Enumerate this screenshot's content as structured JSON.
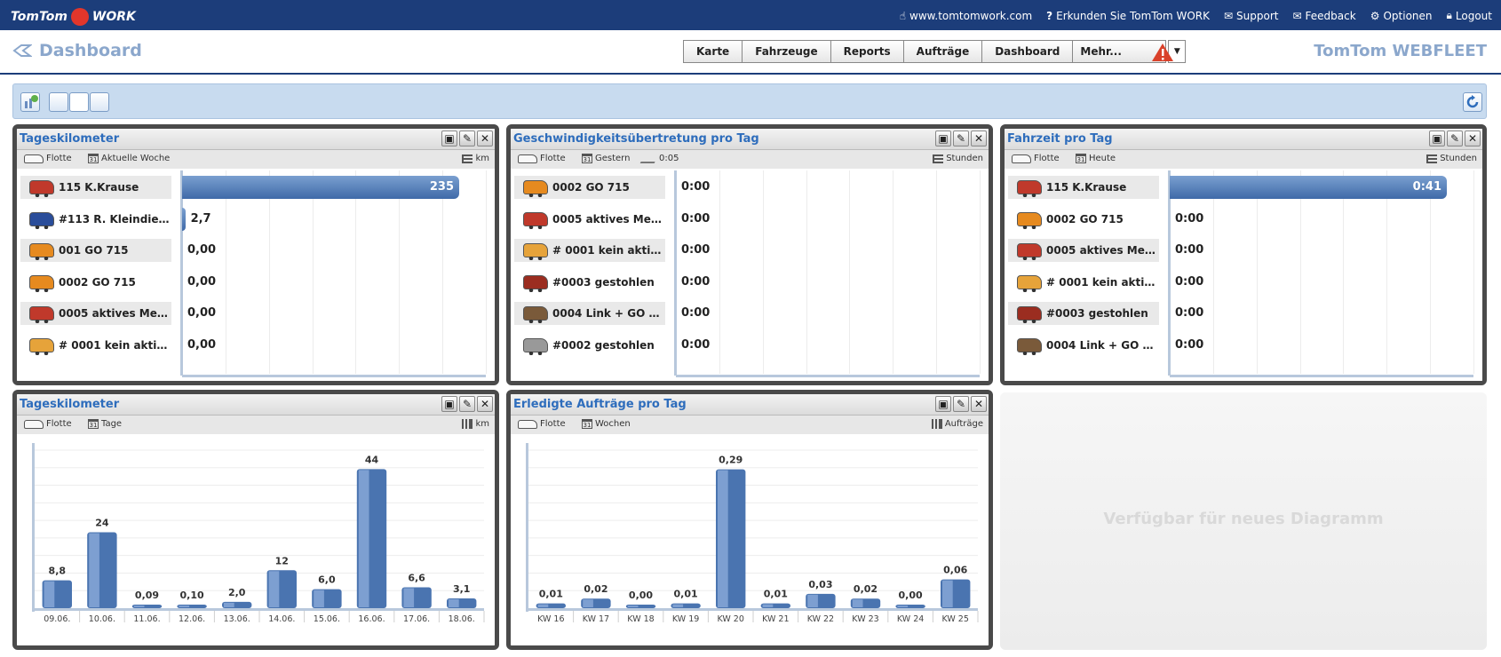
{
  "app": {
    "brand_logo": "TomTom",
    "brand_work": "WORK",
    "product": "TomTom WEBFLEET"
  },
  "toplinks": [
    {
      "icon": "pointer-icon",
      "label": "www.tomtomwork.com"
    },
    {
      "icon": "help-icon",
      "label": "Erkunden Sie TomTom WORK"
    },
    {
      "icon": "mail-icon",
      "label": "Support"
    },
    {
      "icon": "mail-icon",
      "label": "Feedback"
    },
    {
      "icon": "gear-icon",
      "label": "Optionen"
    },
    {
      "icon": "lock-icon",
      "label": "Logout"
    }
  ],
  "page_title": "Dashboard",
  "nav": [
    "Karte",
    "Fahrzeuge",
    "Reports",
    "Aufträge",
    "Dashboard"
  ],
  "nav_more": "Mehr...",
  "available": "Verfügbar für neues Diagramm",
  "colors": {
    "topbar": "#1c3d7a",
    "bar": "#4a74b0",
    "title": "#2e6dbc",
    "warning": "#d9412a"
  },
  "w1": {
    "title": "Tageskilometer",
    "filter1": "Flotte",
    "filter2": "Aktuelle Woche",
    "unit": "km",
    "rows": [
      {
        "vehicle": "115 K.Krause",
        "value": "235",
        "num": 235,
        "color": "#c0392b"
      },
      {
        "vehicle": "#113 R. Kleindiek Ca...",
        "value": "2,7",
        "num": 2.7,
        "color": "#2a4d9a"
      },
      {
        "vehicle": "001 GO 715",
        "value": "0,00",
        "num": 0,
        "color": "#e68a1f"
      },
      {
        "vehicle": "0002 GO 715",
        "value": "0,00",
        "num": 0,
        "color": "#e68a1f"
      },
      {
        "vehicle": "0005 aktives Messe...",
        "value": "0,00",
        "num": 0,
        "color": "#c0392b"
      },
      {
        "vehicle": "# 0001 kein aktives ...",
        "value": "0,00",
        "num": 0,
        "color": "#e6a33a"
      }
    ]
  },
  "w2": {
    "title": "Geschwindigkeitsübertretung pro Tag",
    "filter1": "Flotte",
    "filter2": "Gestern",
    "filter3": "0:05",
    "unit": "Stunden",
    "rows": [
      {
        "vehicle": "0002 GO 715",
        "value": "0:00",
        "color": "#e68a1f"
      },
      {
        "vehicle": "0005 aktives Messe...",
        "value": "0:00",
        "color": "#c0392b"
      },
      {
        "vehicle": "# 0001 kein aktives ...",
        "value": "0:00",
        "color": "#e6a33a"
      },
      {
        "vehicle": "#0003 gestohlen",
        "value": "0:00",
        "color": "#9b2d20"
      },
      {
        "vehicle": "0004 Link + GO 730",
        "value": "0:00",
        "color": "#7a5a3a"
      },
      {
        "vehicle": "#0002 gestohlen",
        "value": "0:00",
        "color": "#999999"
      }
    ]
  },
  "w3": {
    "title": "Fahrzeit pro Tag",
    "filter1": "Flotte",
    "filter2": "Heute",
    "unit": "Stunden",
    "rows": [
      {
        "vehicle": "115 K.Krause",
        "value": "0:41",
        "num": 41,
        "color": "#c0392b"
      },
      {
        "vehicle": "0002 GO 715",
        "value": "0:00",
        "num": 0,
        "color": "#e68a1f"
      },
      {
        "vehicle": "0005 aktives Messe...",
        "value": "0:00",
        "num": 0,
        "color": "#c0392b"
      },
      {
        "vehicle": "# 0001 kein aktives ...",
        "value": "0:00",
        "num": 0,
        "color": "#e6a33a"
      },
      {
        "vehicle": "#0003 gestohlen",
        "value": "0:00",
        "num": 0,
        "color": "#9b2d20"
      },
      {
        "vehicle": "0004 Link + GO 730",
        "value": "0:00",
        "num": 0,
        "color": "#7a5a3a"
      }
    ]
  },
  "w4": {
    "title": "Tageskilometer",
    "filter1": "Flotte",
    "filter2": "Tage",
    "unit": "km"
  },
  "w5": {
    "title": "Erledigte Aufträge pro Tag",
    "filter1": "Flotte",
    "filter2": "Wochen",
    "unit": "Aufträge"
  },
  "chart_data": [
    {
      "type": "bar",
      "title": "Tageskilometer",
      "categories": [
        "09.06.",
        "10.06.",
        "11.06.",
        "12.06.",
        "13.06.",
        "14.06.",
        "15.06.",
        "16.06.",
        "17.06.",
        "18.06."
      ],
      "values": [
        8.8,
        24,
        0.09,
        0.1,
        2.0,
        12,
        6.0,
        44,
        6.6,
        3.1
      ],
      "labels": [
        "8,8",
        "24",
        "0,09",
        "0,10",
        "2,0",
        "12",
        "6,0",
        "44",
        "6,6",
        "3,1"
      ],
      "ylim": [
        0,
        50
      ],
      "ylabel": "km"
    },
    {
      "type": "bar",
      "title": "Erledigte Aufträge pro Tag",
      "categories": [
        "KW 16",
        "KW 17",
        "KW 18",
        "KW 19",
        "KW 20",
        "KW 21",
        "KW 22",
        "KW 23",
        "KW 24",
        "KW 25"
      ],
      "values": [
        0.01,
        0.02,
        0.0,
        0.01,
        0.29,
        0.01,
        0.03,
        0.02,
        0.0,
        0.06
      ],
      "labels": [
        "0,01",
        "0,02",
        "0,00",
        "0,01",
        "0,29",
        "0,01",
        "0,03",
        "0,02",
        "0,00",
        "0,06"
      ],
      "ylim": [
        0,
        0.33
      ],
      "ylabel": "Aufträge"
    }
  ]
}
